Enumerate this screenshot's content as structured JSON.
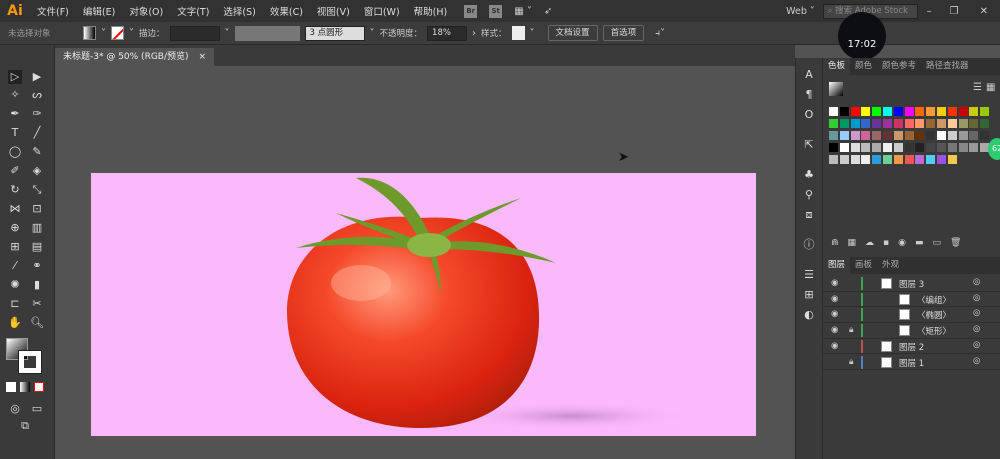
{
  "app": {
    "logo": "Ai",
    "workspace": "Web",
    "search_placeholder": "搜索 Adobe Stock",
    "clock": "17:02"
  },
  "menu": [
    "文件(F)",
    "编辑(E)",
    "对象(O)",
    "文字(T)",
    "选择(S)",
    "效果(C)",
    "视图(V)",
    "窗口(W)",
    "帮助(H)"
  ],
  "menu_icons": {
    "br": "Br",
    "st": "St"
  },
  "control": {
    "selection": "未选择对象",
    "stroke_label": "描边：",
    "brush": "3 点圆形",
    "opacity_label": "不透明度：",
    "opacity": "18%",
    "style_label": "样式：",
    "doc_setup": "文档设置",
    "prefs": "首选项"
  },
  "document": {
    "tab": "未标题-3* @ 50% (RGB/预览)",
    "close": "×"
  },
  "swatches": {
    "tabs": [
      "色板",
      "颜色",
      "颜色参考",
      "路径查找器"
    ],
    "colors": [
      "#ffffff",
      "#000000",
      "#ff0000",
      "#ffff00",
      "#00ff00",
      "#00ffff",
      "#0000ff",
      "#ff00ff",
      "#ff6600",
      "#ff9933",
      "#ffcc00",
      "#ff3300",
      "#cc0000",
      "#cccc00",
      "#99cc00",
      "#33cc33",
      "#009966",
      "#0099cc",
      "#3366cc",
      "#663399",
      "#993399",
      "#cc3366",
      "#ff6666",
      "#ff9966",
      "#996633",
      "#cc9966",
      "#ffcc99",
      "#999966",
      "#666633",
      "#336633",
      "#669999",
      "#99ccff",
      "#cc99cc",
      "#cc6699",
      "#996666",
      "#663333",
      "#cc9966",
      "#996633",
      "#663300",
      "#333333",
      "#ffffff",
      "#cccccc",
      "#999999",
      "#666666",
      "#333333",
      "#000000",
      "#ffffff",
      "#dddddd",
      "#bbbbbb",
      "#aaaaaa",
      "#eeeeee",
      "#cccccc",
      "#333333",
      "#222222",
      "#444444",
      "#555555",
      "#777777",
      "#888888",
      "#999999",
      "#aaaaaa",
      "#bbbbbb",
      "#cccccc",
      "#dddddd",
      "#eeeeee",
      "#2d9cdb",
      "#6fcf97",
      "#f2994a",
      "#eb5757",
      "#bb6bd9",
      "#56ccf2",
      "#9b51e0",
      "#f2c94c"
    ]
  },
  "layers": {
    "tabs": [
      "图层",
      "画板",
      "外观"
    ],
    "rows": [
      {
        "name": "图层 3",
        "indent": 0,
        "color": "#3fa34d",
        "locked": false,
        "visible": true
      },
      {
        "name": "〈编组〉",
        "indent": 1,
        "color": "#3fa34d",
        "locked": false,
        "visible": true
      },
      {
        "name": "〈椭圆〉",
        "indent": 1,
        "color": "#3fa34d",
        "locked": false,
        "visible": true
      },
      {
        "name": "〈矩形〉",
        "indent": 1,
        "color": "#3fa34d",
        "locked": true,
        "visible": true
      },
      {
        "name": "图层 2",
        "indent": 0,
        "color": "#c0504d",
        "locked": false,
        "visible": true
      },
      {
        "name": "图层 1",
        "indent": 0,
        "color": "#4f81bd",
        "locked": true,
        "visible": false
      }
    ]
  },
  "colors": {
    "artboard": "#fab9fa",
    "badge": "#2ecc71"
  },
  "badge": "62"
}
